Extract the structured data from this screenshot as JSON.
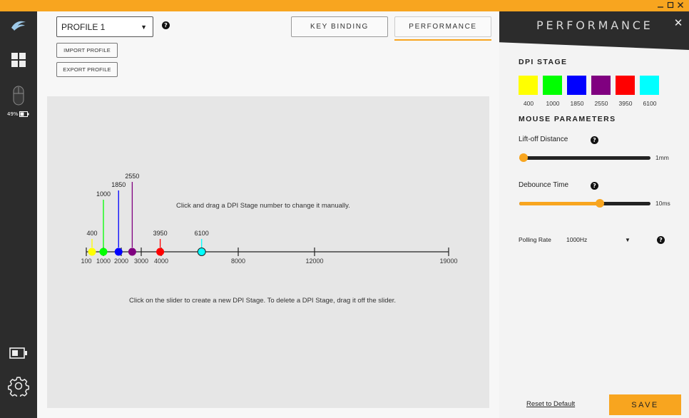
{
  "window": {
    "controls": [
      "minimize",
      "maximize",
      "close"
    ],
    "accent_color": "#f8a51f"
  },
  "sidebar": {
    "icons": [
      "logo-icon",
      "grid-icon",
      "mouse-icon",
      "battery-icon",
      "settings-icon"
    ],
    "battery_percent_text": "49%",
    "battery_level": 0.49
  },
  "main": {
    "profile_select": {
      "value": "PROFILE 1"
    },
    "import_profile_label": "IMPORT PROFILE",
    "export_profile_label": "EXPORT PROFILE",
    "tabs": [
      {
        "label": "KEY BINDING",
        "active": false
      },
      {
        "label": "PERFORMANCE",
        "active": true
      }
    ],
    "hint_drag": "Click and drag a DPI Stage number to change it manually.",
    "hint_create": "Click on the slider to create a new DPI Stage. To delete a DPI Stage, drag it off the slider."
  },
  "dpi_slider": {
    "ticks": [
      {
        "value": 100,
        "label": "100"
      },
      {
        "value": 1000,
        "label": "1000"
      },
      {
        "value": 2000,
        "label": "2000"
      },
      {
        "value": 3000,
        "label": "3000"
      },
      {
        "value": 4000,
        "label": "4000"
      },
      {
        "value": 8000,
        "label": "8000"
      },
      {
        "value": 12000,
        "label": "12000"
      },
      {
        "value": 19000,
        "label": "19000"
      }
    ],
    "stages": [
      {
        "value": 400,
        "label": "400",
        "color": "#ffff00",
        "level": 0
      },
      {
        "value": 1000,
        "label": "1000",
        "color": "#00ff00",
        "level": 3
      },
      {
        "value": 1850,
        "label": "1850",
        "color": "#0000ff",
        "level": 4
      },
      {
        "value": 2550,
        "label": "2550",
        "color": "#800080",
        "level": 5
      },
      {
        "value": 3950,
        "label": "3950",
        "color": "#ff0000",
        "level": 0
      },
      {
        "value": 6100,
        "label": "6100",
        "color": "#00ffff",
        "level": 0
      }
    ]
  },
  "panel": {
    "title": "PERFORMANCE",
    "dpi_stage_heading": "DPI STAGE",
    "dpi_stages": [
      {
        "label": "400",
        "color": "#ffff00"
      },
      {
        "label": "1000",
        "color": "#00ff00"
      },
      {
        "label": "1850",
        "color": "#0000ff"
      },
      {
        "label": "2550",
        "color": "#800080"
      },
      {
        "label": "3950",
        "color": "#ff0000"
      },
      {
        "label": "6100",
        "color": "#00ffff"
      }
    ],
    "mouse_params_heading": "MOUSE PARAMETERS",
    "liftoff": {
      "label": "Lift-off Distance",
      "value_text": "1mm",
      "fraction": 0.0
    },
    "debounce": {
      "label": "Debounce Time",
      "value_text": "10ms",
      "fraction": 0.62
    },
    "polling": {
      "label": "Polling Rate",
      "value": "1000Hz"
    },
    "reset_label": "Reset to Default",
    "save_label": "SAVE"
  }
}
